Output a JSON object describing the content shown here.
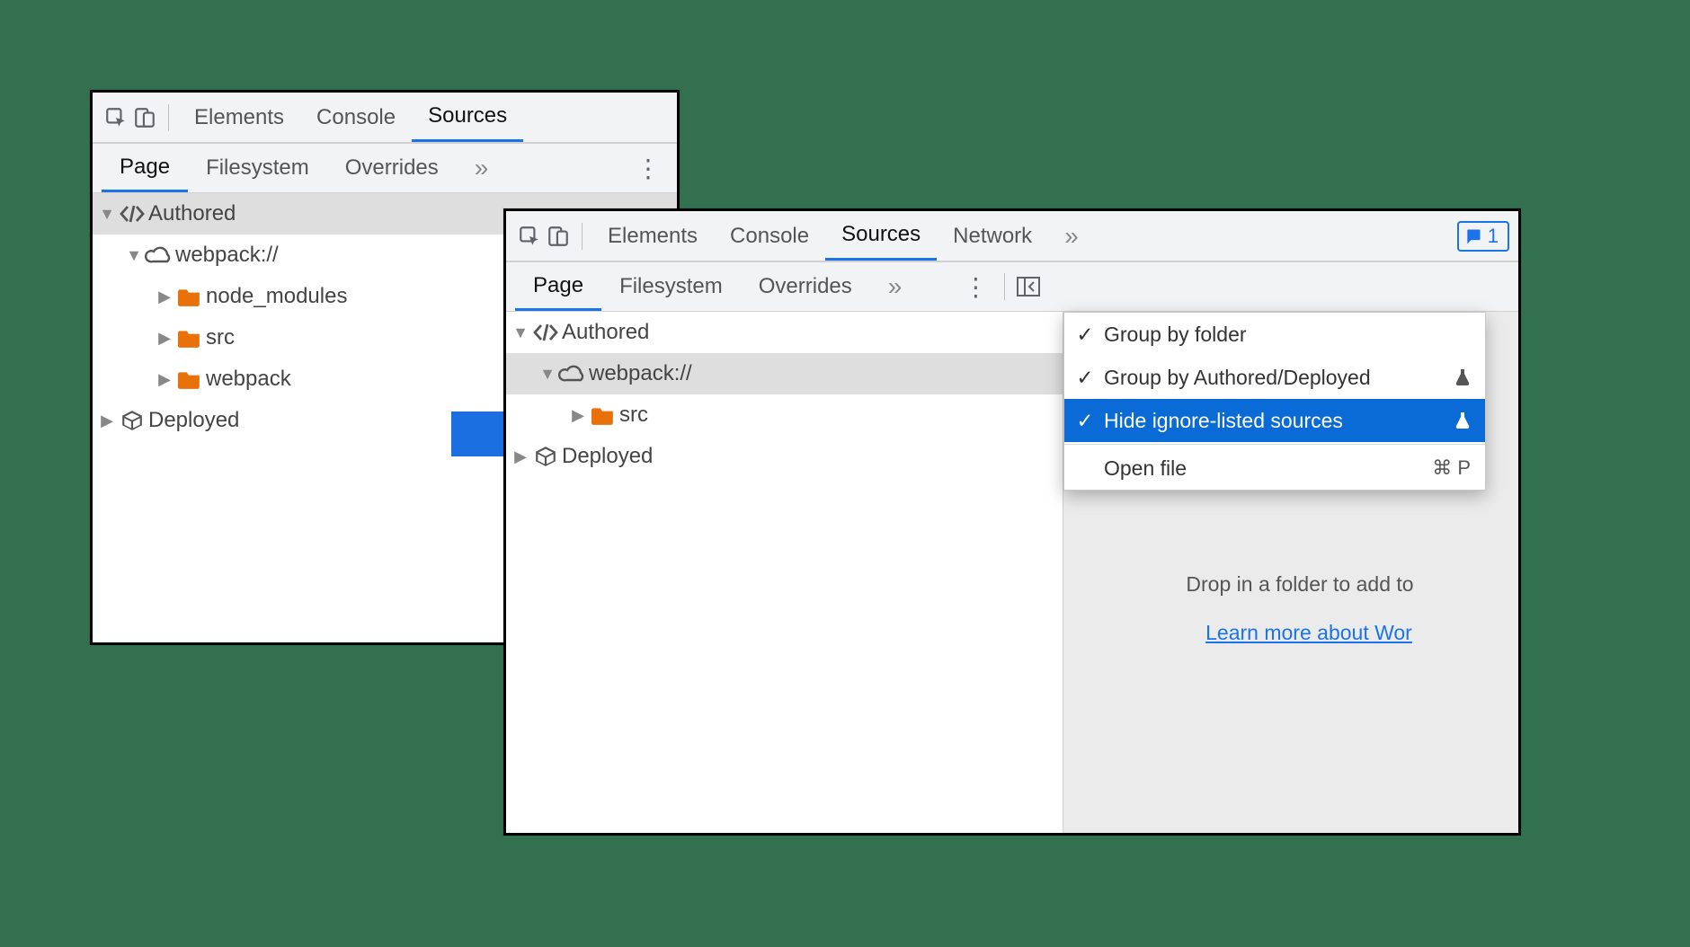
{
  "left_panel": {
    "top_tabs": {
      "elements": "Elements",
      "console": "Console",
      "sources": "Sources"
    },
    "sub_tabs": {
      "page": "Page",
      "filesystem": "Filesystem",
      "overrides": "Overrides"
    },
    "tree": {
      "authored": "Authored",
      "webpack": "webpack://",
      "node_modules": "node_modules",
      "src": "src",
      "webpack_folder": "webpack",
      "deployed": "Deployed"
    }
  },
  "right_panel": {
    "top_tabs": {
      "elements": "Elements",
      "console": "Console",
      "sources": "Sources",
      "network": "Network"
    },
    "feedback_count": "1",
    "sub_tabs": {
      "page": "Page",
      "filesystem": "Filesystem",
      "overrides": "Overrides"
    },
    "tree": {
      "authored": "Authored",
      "webpack": "webpack://",
      "src": "src",
      "deployed": "Deployed"
    },
    "context_menu": {
      "group_by_folder": "Group by folder",
      "group_by_authored": "Group by Authored/Deployed",
      "hide_ignore": "Hide ignore-listed sources",
      "open_file": "Open file",
      "open_file_shortcut": "⌘ P"
    },
    "hint_line1": "Drop in a folder to add to",
    "hint_link": "Learn more about Wor"
  }
}
